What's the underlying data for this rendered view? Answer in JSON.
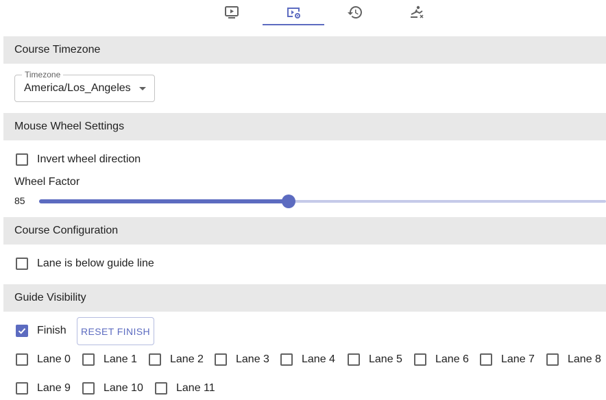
{
  "tabs": [
    {
      "icon": "play-screen-icon",
      "active": false
    },
    {
      "icon": "play-settings-icon",
      "active": true
    },
    {
      "icon": "history-icon",
      "active": false
    },
    {
      "icon": "rower-icon",
      "active": false
    }
  ],
  "sections": {
    "timezone": "Course Timezone",
    "mouse_wheel": "Mouse Wheel Settings",
    "course_config": "Course Configuration",
    "guide_visibility": "Guide Visibility"
  },
  "timezone": {
    "legend": "Timezone",
    "value": "America/Los_Angeles"
  },
  "mouse_wheel": {
    "invert_label": "Invert wheel direction",
    "invert_checked": false,
    "factor_label": "Wheel Factor",
    "factor_value": "85",
    "slider_fraction": 0.44
  },
  "course_config": {
    "lane_below_label": "Lane is below guide line",
    "lane_below_checked": false
  },
  "guide_visibility": {
    "finish_label": "Finish",
    "finish_checked": true,
    "reset_label": "RESET FINISH",
    "lanes": [
      "Lane 0",
      "Lane 1",
      "Lane 2",
      "Lane 3",
      "Lane 4",
      "Lane 5",
      "Lane 6",
      "Lane 7",
      "Lane 8",
      "Lane 9",
      "Lane 10",
      "Lane 11"
    ]
  },
  "colors": {
    "accent": "#5c6bc0",
    "accent_light": "#c5cae9",
    "header_bg": "#e8e8e8"
  }
}
